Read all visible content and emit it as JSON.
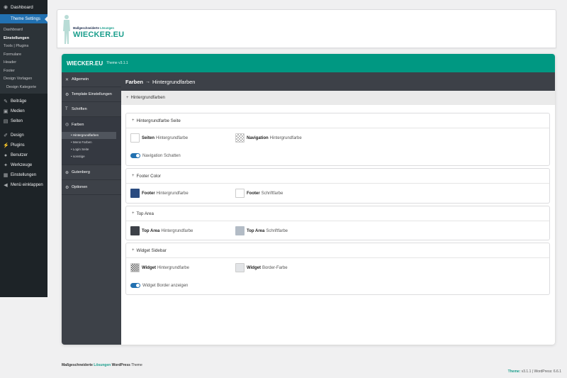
{
  "wp_sidebar": {
    "dashboard": "Dashboard",
    "active": "Theme Settings",
    "submenu": [
      {
        "label": "Dashboard",
        "bold": false,
        "indent": false
      },
      {
        "label": "Einstellungen",
        "bold": true,
        "indent": false
      },
      {
        "label": "Tools | Plugins",
        "bold": false,
        "indent": false
      },
      {
        "label": "Formulare",
        "bold": false,
        "indent": false
      },
      {
        "label": "Header",
        "bold": false,
        "indent": false
      },
      {
        "label": "Footer",
        "bold": false,
        "indent": false
      },
      {
        "label": "Design Vorlagen",
        "bold": false,
        "indent": false
      },
      {
        "label": "Design Kategorie",
        "bold": false,
        "indent": true
      }
    ],
    "menu": {
      "beitraege": "Beiträge",
      "medien": "Medien",
      "seiten": "Seiten",
      "design": "Design",
      "plugins": "Plugins",
      "benutzer": "Benutzer",
      "werkzeuge": "Werkzeuge",
      "einstellungen": "Einstellungen",
      "collapse": "Menü einklappen"
    }
  },
  "logo": {
    "sub_prefix": "Maßgeschneiderte ",
    "sub_accent": "Lösungen",
    "main": "WIECKER.EU"
  },
  "theme": {
    "brand": "WIECKER.EU",
    "version": "Theme v3.1.1",
    "nav": {
      "allgemein": "Allgemein",
      "template": "Template Einstellungen",
      "schriften": "Schriften",
      "farben": "Farben",
      "farben_sub": [
        "Hintergrundfarben",
        "Menü Farben",
        "Login Seite",
        "sonstige"
      ],
      "gutenberg": "Gutenberg",
      "optionen": "Optionen"
    },
    "breadcrumb": {
      "section": "Farben",
      "current": "Hintergrundfarben"
    },
    "subhead": "Hintergrundfarben",
    "boxes": {
      "seite": {
        "title": "Hintergrundfarbe Seite",
        "seiten_label": "Seiten",
        "seiten_desc": "Hintergrundfarbe",
        "nav_label": "Navigation",
        "nav_desc": "Hintergrundfarbe",
        "shadow_toggle": "Navigation Schatten"
      },
      "footer": {
        "title": "Footer Color",
        "bg_label": "Footer",
        "bg_desc": "Hintergrundfarbe",
        "font_label": "Footer",
        "font_desc": "Schriftfarbe"
      },
      "toparea": {
        "title": "Top Area",
        "bg_label": "Top Area",
        "bg_desc": "Hintergrundfarbe",
        "font_label": "Top Area",
        "font_desc": "Schriftfarbe"
      },
      "widget": {
        "title": "Widget Sidebar",
        "bg_label": "Widget",
        "bg_desc": "Hintergrundfarbe",
        "border_label": "Widget",
        "border_desc": "Border-Farbe",
        "border_toggle": "Widget Border anzeigen"
      }
    }
  },
  "colors": {
    "accent": "#009882",
    "footer_bg": "#2a4b80",
    "top_area_bg": "#3d4148",
    "top_area_font": "#b3bcc6",
    "widget_border": "#e2e4e7",
    "toggle_on": "#2271b1"
  },
  "footer": {
    "left_prefix": "Maßgeschneiderte ",
    "left_accent": "Lösungen",
    "left_wp": " WordPress",
    "left_suffix": " Theme",
    "theme_label": "Theme:",
    "theme_version": " v3.1.1",
    "wp_version": "  |  WordPress: 6.6.1"
  }
}
